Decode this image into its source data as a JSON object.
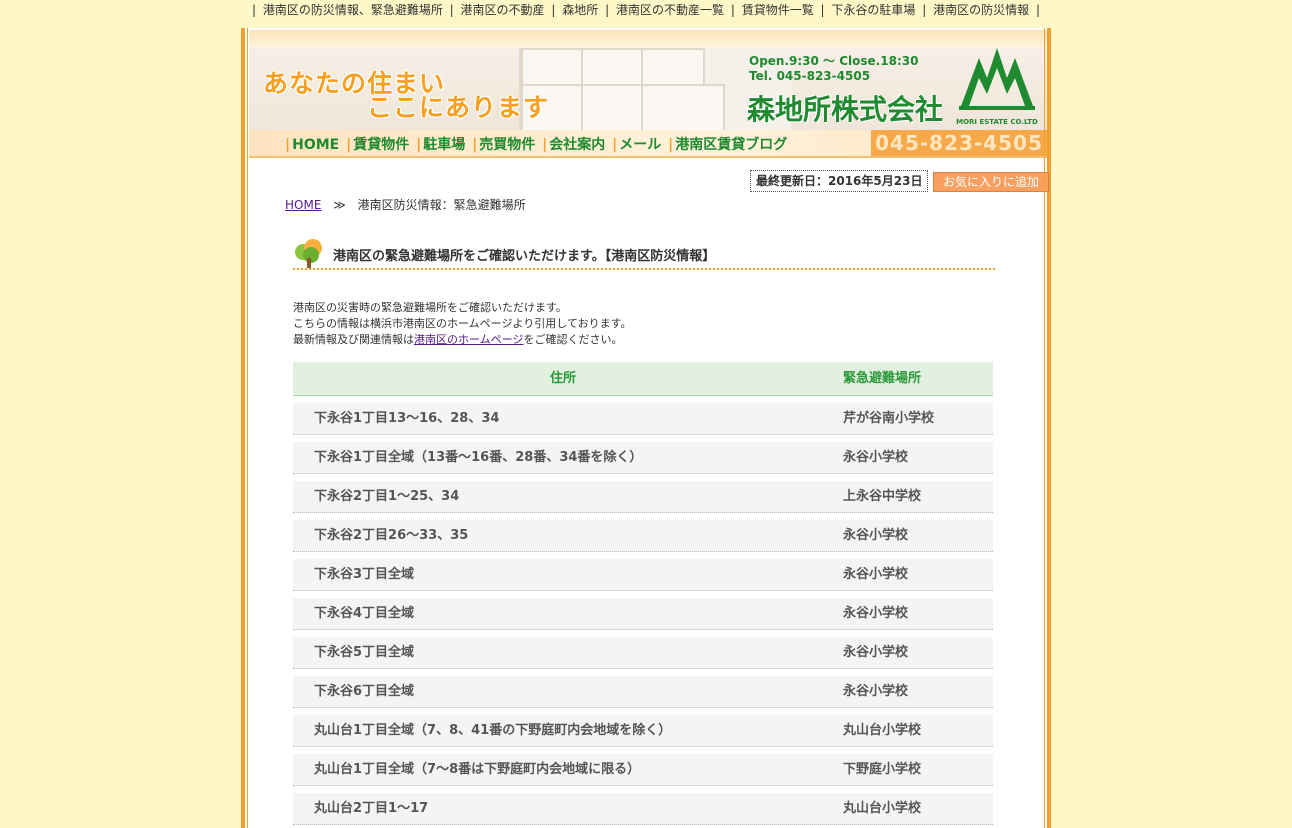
{
  "topbar": {
    "links": [
      "港南区の防災情報、緊急避難場所",
      "港南区の不動産",
      "森地所",
      "港南区の不動産一覧",
      "賃貸物件一覧",
      "下永谷の駐車場",
      "港南区の防災情報"
    ],
    "separator": "|"
  },
  "header": {
    "catch_line1": "あなたの住まい",
    "catch_line2": "ここにあります",
    "hours": "Open.9:30 〜 Close.18:30",
    "tel": "Tel. 045-823-4505",
    "company": "森地所株式会社",
    "logo_text": "MORI ESTATE CO.LTD"
  },
  "nav": {
    "items": [
      "HOME",
      "賃貸物件",
      "駐車場",
      "売買物件",
      "会社案内",
      "メール",
      "港南区賃貸ブログ"
    ],
    "phone": "045-823-4505"
  },
  "updated": "最終更新日：2016年5月23日",
  "favorite_button": "お気に入りに追加",
  "breadcrumb": {
    "home": "HOME",
    "arrow": "≫",
    "current": "港南区防災情報：緊急避難場所"
  },
  "heading": "港南区の緊急避難場所をご確認いただけます。【港南区防災情報】",
  "intro": {
    "line1": "港南区の災害時の緊急避難場所をご確認いただけます。",
    "line2": "こちらの情報は横浜市港南区のホームページより引用しております。",
    "line3_before": "最新情報及び関連情報は",
    "line3_link": "港南区のホームページ",
    "line3_after": "をご確認ください。"
  },
  "table": {
    "headers": [
      "住所",
      "緊急避難場所"
    ],
    "rows": [
      [
        "下永谷1丁目13〜16、28、34",
        "芹が谷南小学校"
      ],
      [
        "下永谷1丁目全域（13番〜16番、28番、34番を除く）",
        "永谷小学校"
      ],
      [
        "下永谷2丁目1〜25、34",
        "上永谷中学校"
      ],
      [
        "下永谷2丁目26〜33、35",
        "永谷小学校"
      ],
      [
        "下永谷3丁目全域",
        "永谷小学校"
      ],
      [
        "下永谷4丁目全域",
        "永谷小学校"
      ],
      [
        "下永谷5丁目全域",
        "永谷小学校"
      ],
      [
        "下永谷6丁目全域",
        "永谷小学校"
      ],
      [
        "丸山台1丁目全域（7、8、41番の下野庭町内会地域を除く）",
        "丸山台小学校"
      ],
      [
        "丸山台1丁目全域（7〜8番は下野庭町内会地域に限る）",
        "下野庭小学校"
      ],
      [
        "丸山台2丁目1〜17",
        "丸山台小学校"
      ]
    ]
  },
  "colors": {
    "accent_orange": "#f0a030",
    "brand_green": "#1f8a30",
    "page_bg": "#fef8c8"
  }
}
